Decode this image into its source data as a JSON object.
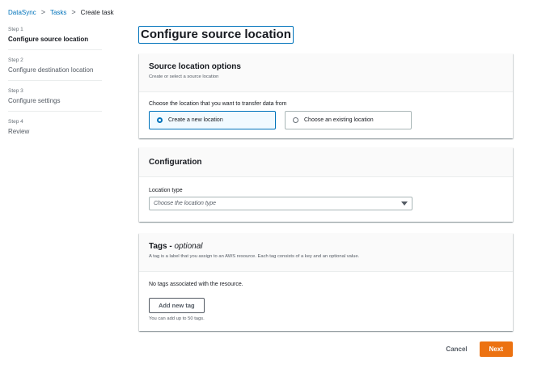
{
  "breadcrumb": {
    "items": [
      "DataSync",
      "Tasks",
      "Create task"
    ],
    "separator": ">"
  },
  "steps": [
    {
      "num": "Step 1",
      "title": "Configure source location",
      "active": true
    },
    {
      "num": "Step 2",
      "title": "Configure destination location",
      "active": false
    },
    {
      "num": "Step 3",
      "title": "Configure settings",
      "active": false
    },
    {
      "num": "Step 4",
      "title": "Review",
      "active": false
    }
  ],
  "page_title": "Configure source location",
  "source_options": {
    "title": "Source location options",
    "description": "Create or select a source location",
    "choose_label": "Choose the location that you want to transfer data from",
    "tiles": [
      {
        "label": "Create a new location",
        "selected": true
      },
      {
        "label": "Choose an existing location",
        "selected": false
      }
    ]
  },
  "configuration": {
    "title": "Configuration",
    "location_type_label": "Location type",
    "location_type_placeholder": "Choose the location type"
  },
  "tags": {
    "title": "Tags - ",
    "title_optional": "optional",
    "description": "A tag is a label that you assign to an AWS resource. Each tag consists of a key and an optional value.",
    "empty_text": "No tags associated with the resource.",
    "add_button": "Add new tag",
    "hint": "You can add up to 50 tags."
  },
  "footer": {
    "cancel": "Cancel",
    "next": "Next"
  },
  "colors": {
    "link": "#0073bb",
    "primary": "#ec7211",
    "selected_bg": "#f1faff"
  }
}
